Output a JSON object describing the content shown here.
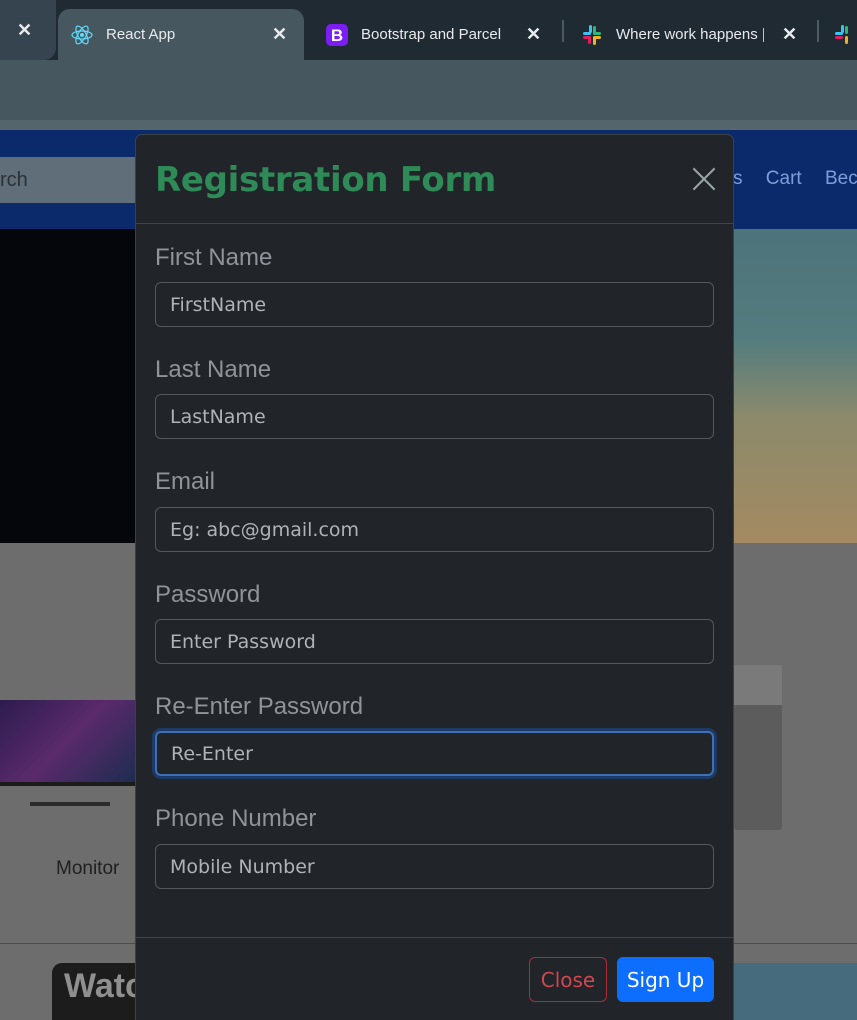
{
  "browser": {
    "tabs": [
      {
        "title": "React App",
        "active": true,
        "icon": "react-icon"
      },
      {
        "title": "Bootstrap and Parcel ·",
        "active": false,
        "icon": "bootstrap-icon"
      },
      {
        "title": "Where work happens |",
        "active": false,
        "icon": "slack-icon"
      }
    ],
    "close_glyph": "✕"
  },
  "page": {
    "search_placeholder": "rch",
    "nav_links": [
      "s",
      "Cart",
      "Beco"
    ],
    "monitor_label": "Monitor",
    "watch_title": "Watc"
  },
  "modal": {
    "title": "Registration Form",
    "title_color": "#2e8b57",
    "fields": [
      {
        "label": "First Name",
        "placeholder": "FirstName"
      },
      {
        "label": "Last Name",
        "placeholder": "LastName"
      },
      {
        "label": "Email",
        "placeholder": "Eg: abc@gmail.com"
      },
      {
        "label": "Password",
        "placeholder": "Enter Password"
      },
      {
        "label": "Re-Enter Password",
        "placeholder": "Re-Enter",
        "focused": true
      },
      {
        "label": "Phone Number",
        "placeholder": "Mobile Number"
      }
    ],
    "buttons": {
      "close": "Close",
      "signup": "Sign Up"
    }
  }
}
